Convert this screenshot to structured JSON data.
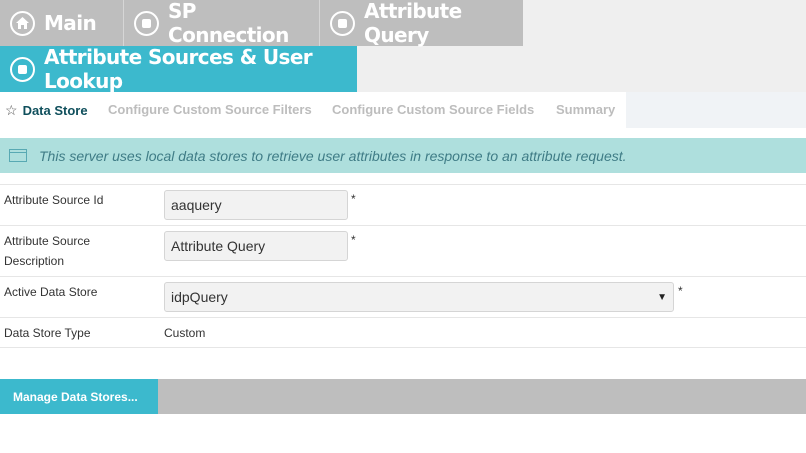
{
  "breadcrumbs": {
    "main": "Main",
    "sp_connection": "SP Connection",
    "attribute_query": "Attribute Query",
    "current": "Attribute Sources & User Lookup"
  },
  "tabs": [
    {
      "label": "Data Store",
      "active": true
    },
    {
      "label": "Configure Custom Source Filters",
      "active": false
    },
    {
      "label": "Configure Custom Source Fields",
      "active": false
    },
    {
      "label": "Summary",
      "active": false
    }
  ],
  "info": {
    "message": "This server uses local data stores to retrieve user attributes in response to an attribute request."
  },
  "form": {
    "attribute_source_id": {
      "label": "Attribute Source Id",
      "value": "aaquery",
      "required_mark": "*"
    },
    "attribute_source_description": {
      "label": "Attribute Source Description",
      "value": "Attribute Query",
      "required_mark": "*"
    },
    "active_data_store": {
      "label": "Active Data Store",
      "value": "idpQuery",
      "required_mark": "*"
    },
    "data_store_type": {
      "label": "Data Store Type",
      "value": "Custom"
    }
  },
  "actions": {
    "manage_data_stores": "Manage Data Stores..."
  },
  "colors": {
    "accent": "#3cb9cd",
    "breadcrumb_gray": "#bebebe",
    "info_bg": "#aedfdd",
    "active_tab_text": "#0f4f5c"
  }
}
